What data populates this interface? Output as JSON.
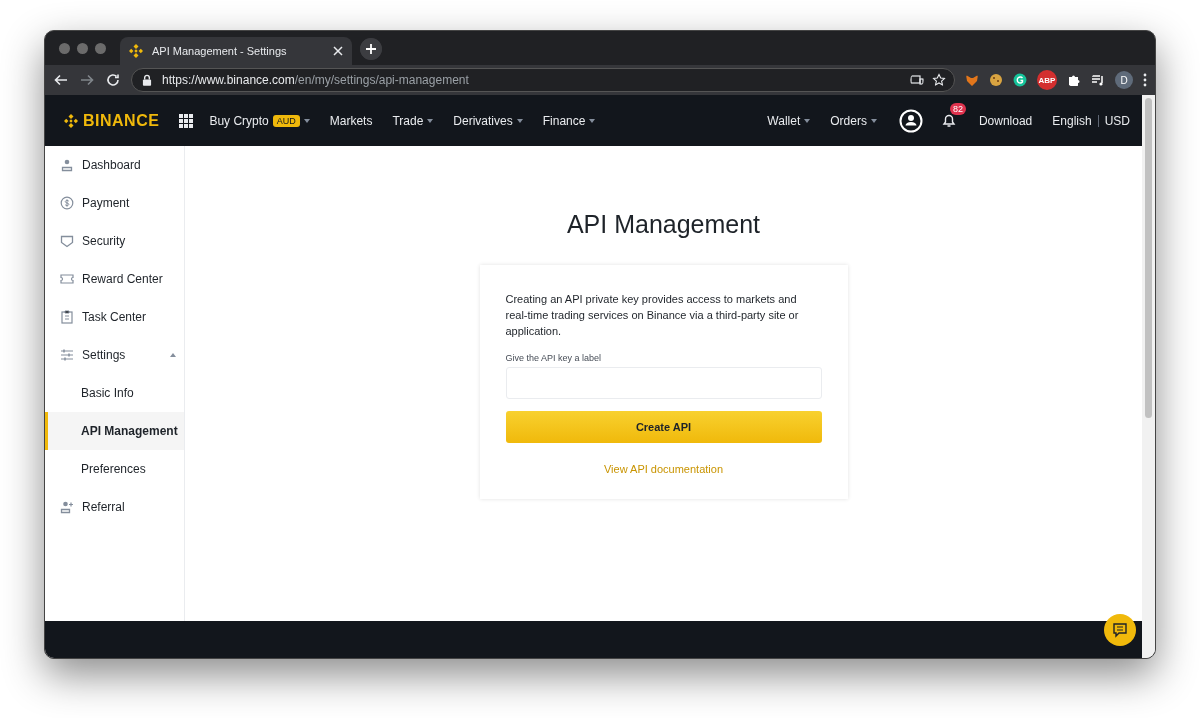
{
  "browser": {
    "tab_title": "API Management - Settings",
    "url_host": "https://www.binance.com",
    "url_path": "/en/my/settings/api-management",
    "extensions": [
      {
        "kind": "fox"
      },
      {
        "kind": "cookie"
      },
      {
        "kind": "grammar"
      },
      {
        "kind": "adblock",
        "label": "ABP"
      },
      {
        "kind": "puzzle"
      },
      {
        "kind": "media"
      }
    ],
    "profile_initial": "D"
  },
  "header": {
    "logo": "BINANCE",
    "nav": [
      {
        "label": "Buy Crypto",
        "badge": "AUD",
        "dropdown": true
      },
      {
        "label": "Markets",
        "dropdown": false
      },
      {
        "label": "Trade",
        "dropdown": true
      },
      {
        "label": "Derivatives",
        "dropdown": true
      },
      {
        "label": "Finance",
        "dropdown": true
      }
    ],
    "right_nav": [
      {
        "label": "Wallet",
        "dropdown": true
      },
      {
        "label": "Orders",
        "dropdown": true
      }
    ],
    "notification_count": "82",
    "download": "Download",
    "language": "English",
    "currency": "USD"
  },
  "sidebar": {
    "items": [
      {
        "label": "Dashboard",
        "kind": "person",
        "selected": false
      },
      {
        "label": "Payment",
        "kind": "dollar",
        "selected": false
      },
      {
        "label": "Security",
        "kind": "shield",
        "selected": false
      },
      {
        "label": "Reward Center",
        "kind": "ticket",
        "selected": false
      },
      {
        "label": "Task Center",
        "kind": "clipboard",
        "selected": false
      },
      {
        "label": "Settings",
        "kind": "sliders",
        "selected": false,
        "expanded": true,
        "children": [
          {
            "label": "Basic Info",
            "selected": false
          },
          {
            "label": "API Management",
            "selected": true
          },
          {
            "label": "Preferences",
            "selected": false
          }
        ]
      },
      {
        "label": "Referral",
        "kind": "person-add",
        "selected": false
      }
    ]
  },
  "main": {
    "title": "API Management",
    "card": {
      "description": "Creating an API private key provides access to markets and real-time trading services on Binance via a third-party site or application.",
      "field_label": "Give the API key a label",
      "button": "Create API",
      "link": "View API documentation"
    }
  }
}
